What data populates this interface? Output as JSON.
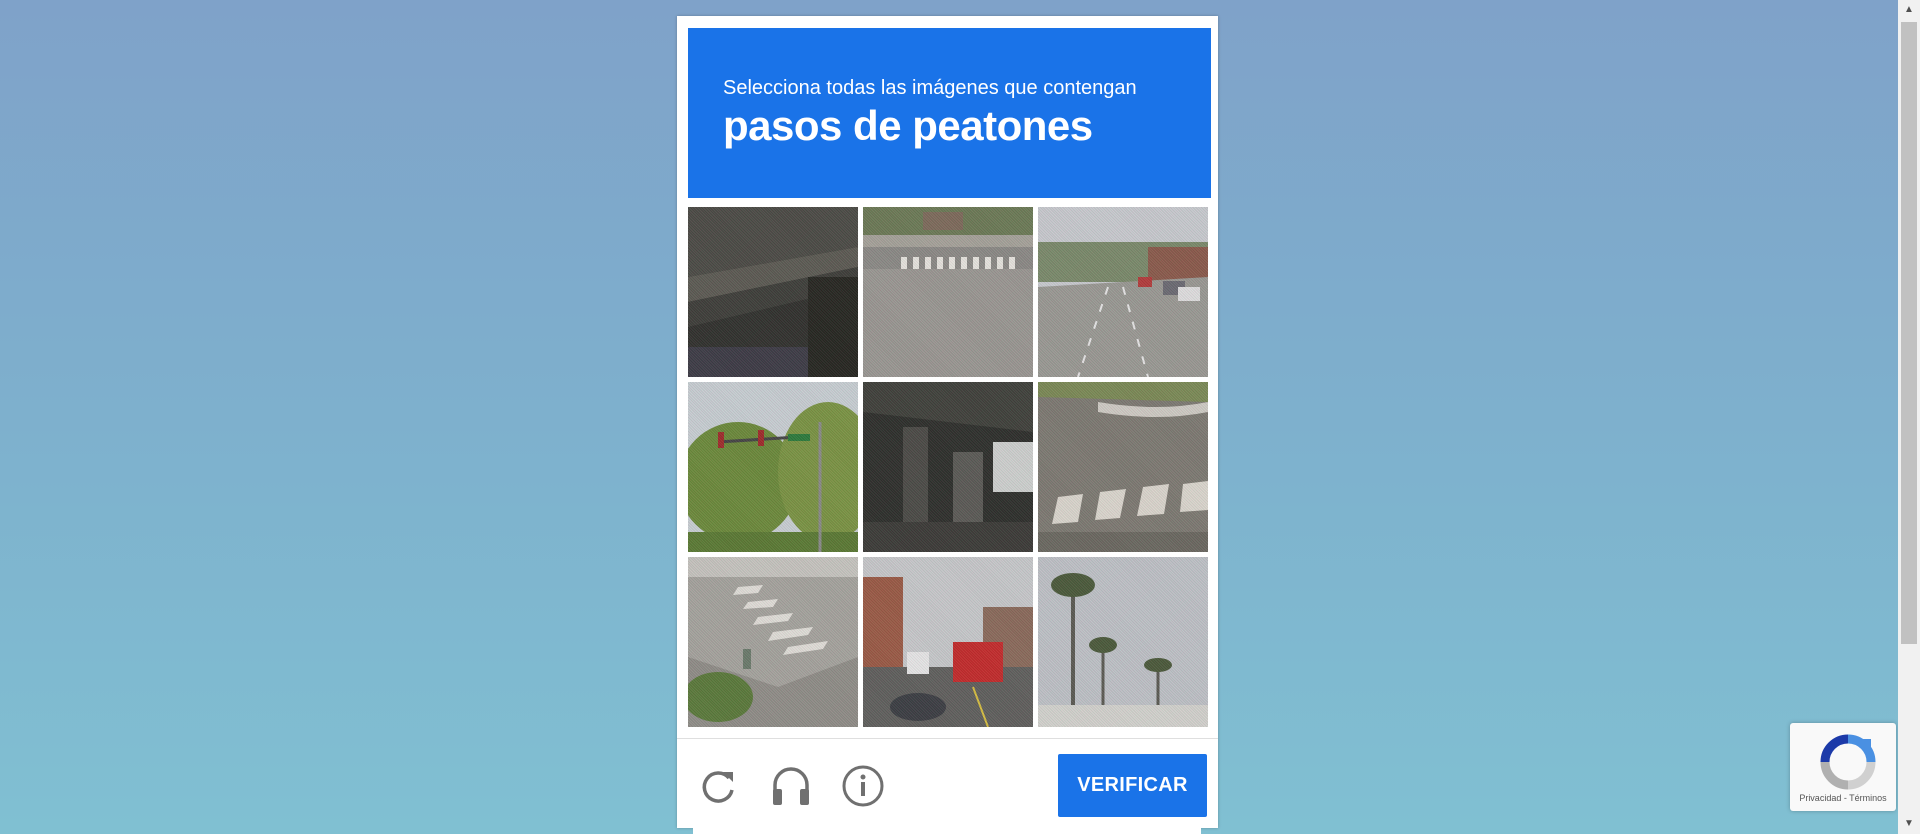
{
  "challenge": {
    "instruction": "Selecciona todas las imágenes que contengan",
    "target": "pasos de peatones"
  },
  "tiles": [
    {
      "scene": "overpass-underside"
    },
    {
      "scene": "crosswalk-intersection"
    },
    {
      "scene": "street-with-cars"
    },
    {
      "scene": "traffic-lights-trees"
    },
    {
      "scene": "overpass-pillars"
    },
    {
      "scene": "crosswalk-curb"
    },
    {
      "scene": "crosswalk-sidewalk"
    },
    {
      "scene": "street-red-bus"
    },
    {
      "scene": "palm-trees"
    }
  ],
  "footer": {
    "reload_icon": "reload-icon",
    "audio_icon": "headphones-icon",
    "info_icon": "info-icon",
    "verify_label": "VERIFICAR"
  },
  "recaptcha_badge": {
    "links": "Privacidad - Términos"
  },
  "colors": {
    "accent": "#1a73e8",
    "icon_gray": "#707070"
  }
}
